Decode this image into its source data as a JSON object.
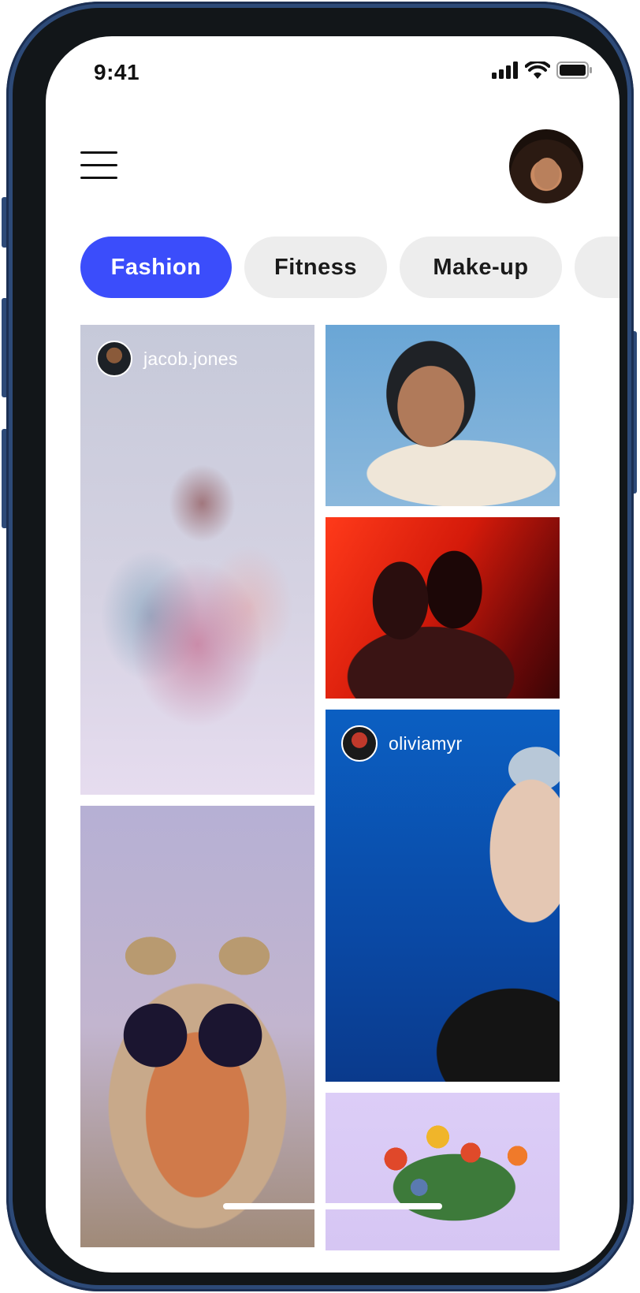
{
  "status_bar": {
    "time": "9:41"
  },
  "header": {
    "menu_icon": "hamburger-menu-icon",
    "profile_avatar": "profile-avatar"
  },
  "categories": [
    {
      "label": "Fashion",
      "active": true
    },
    {
      "label": "Fitness",
      "active": false
    },
    {
      "label": "Make-up",
      "active": false
    }
  ],
  "feed": {
    "posts": [
      {
        "username": "jacob.jones",
        "image": "group-fashion-photo"
      },
      {
        "username": "",
        "image": "woman-in-bathtub-photo"
      },
      {
        "username": "",
        "image": "two-women-red-light-photo"
      },
      {
        "username": "oliviamyr",
        "image": "silver-makeup-portrait-photo"
      },
      {
        "username": "",
        "image": "woman-with-sunglasses-photo"
      },
      {
        "username": "",
        "image": "flowers-purple-background-photo"
      }
    ]
  },
  "colors": {
    "accent": "#3B4DFB",
    "chip_bg": "#EDEDED",
    "frame": "#2D4A78"
  }
}
